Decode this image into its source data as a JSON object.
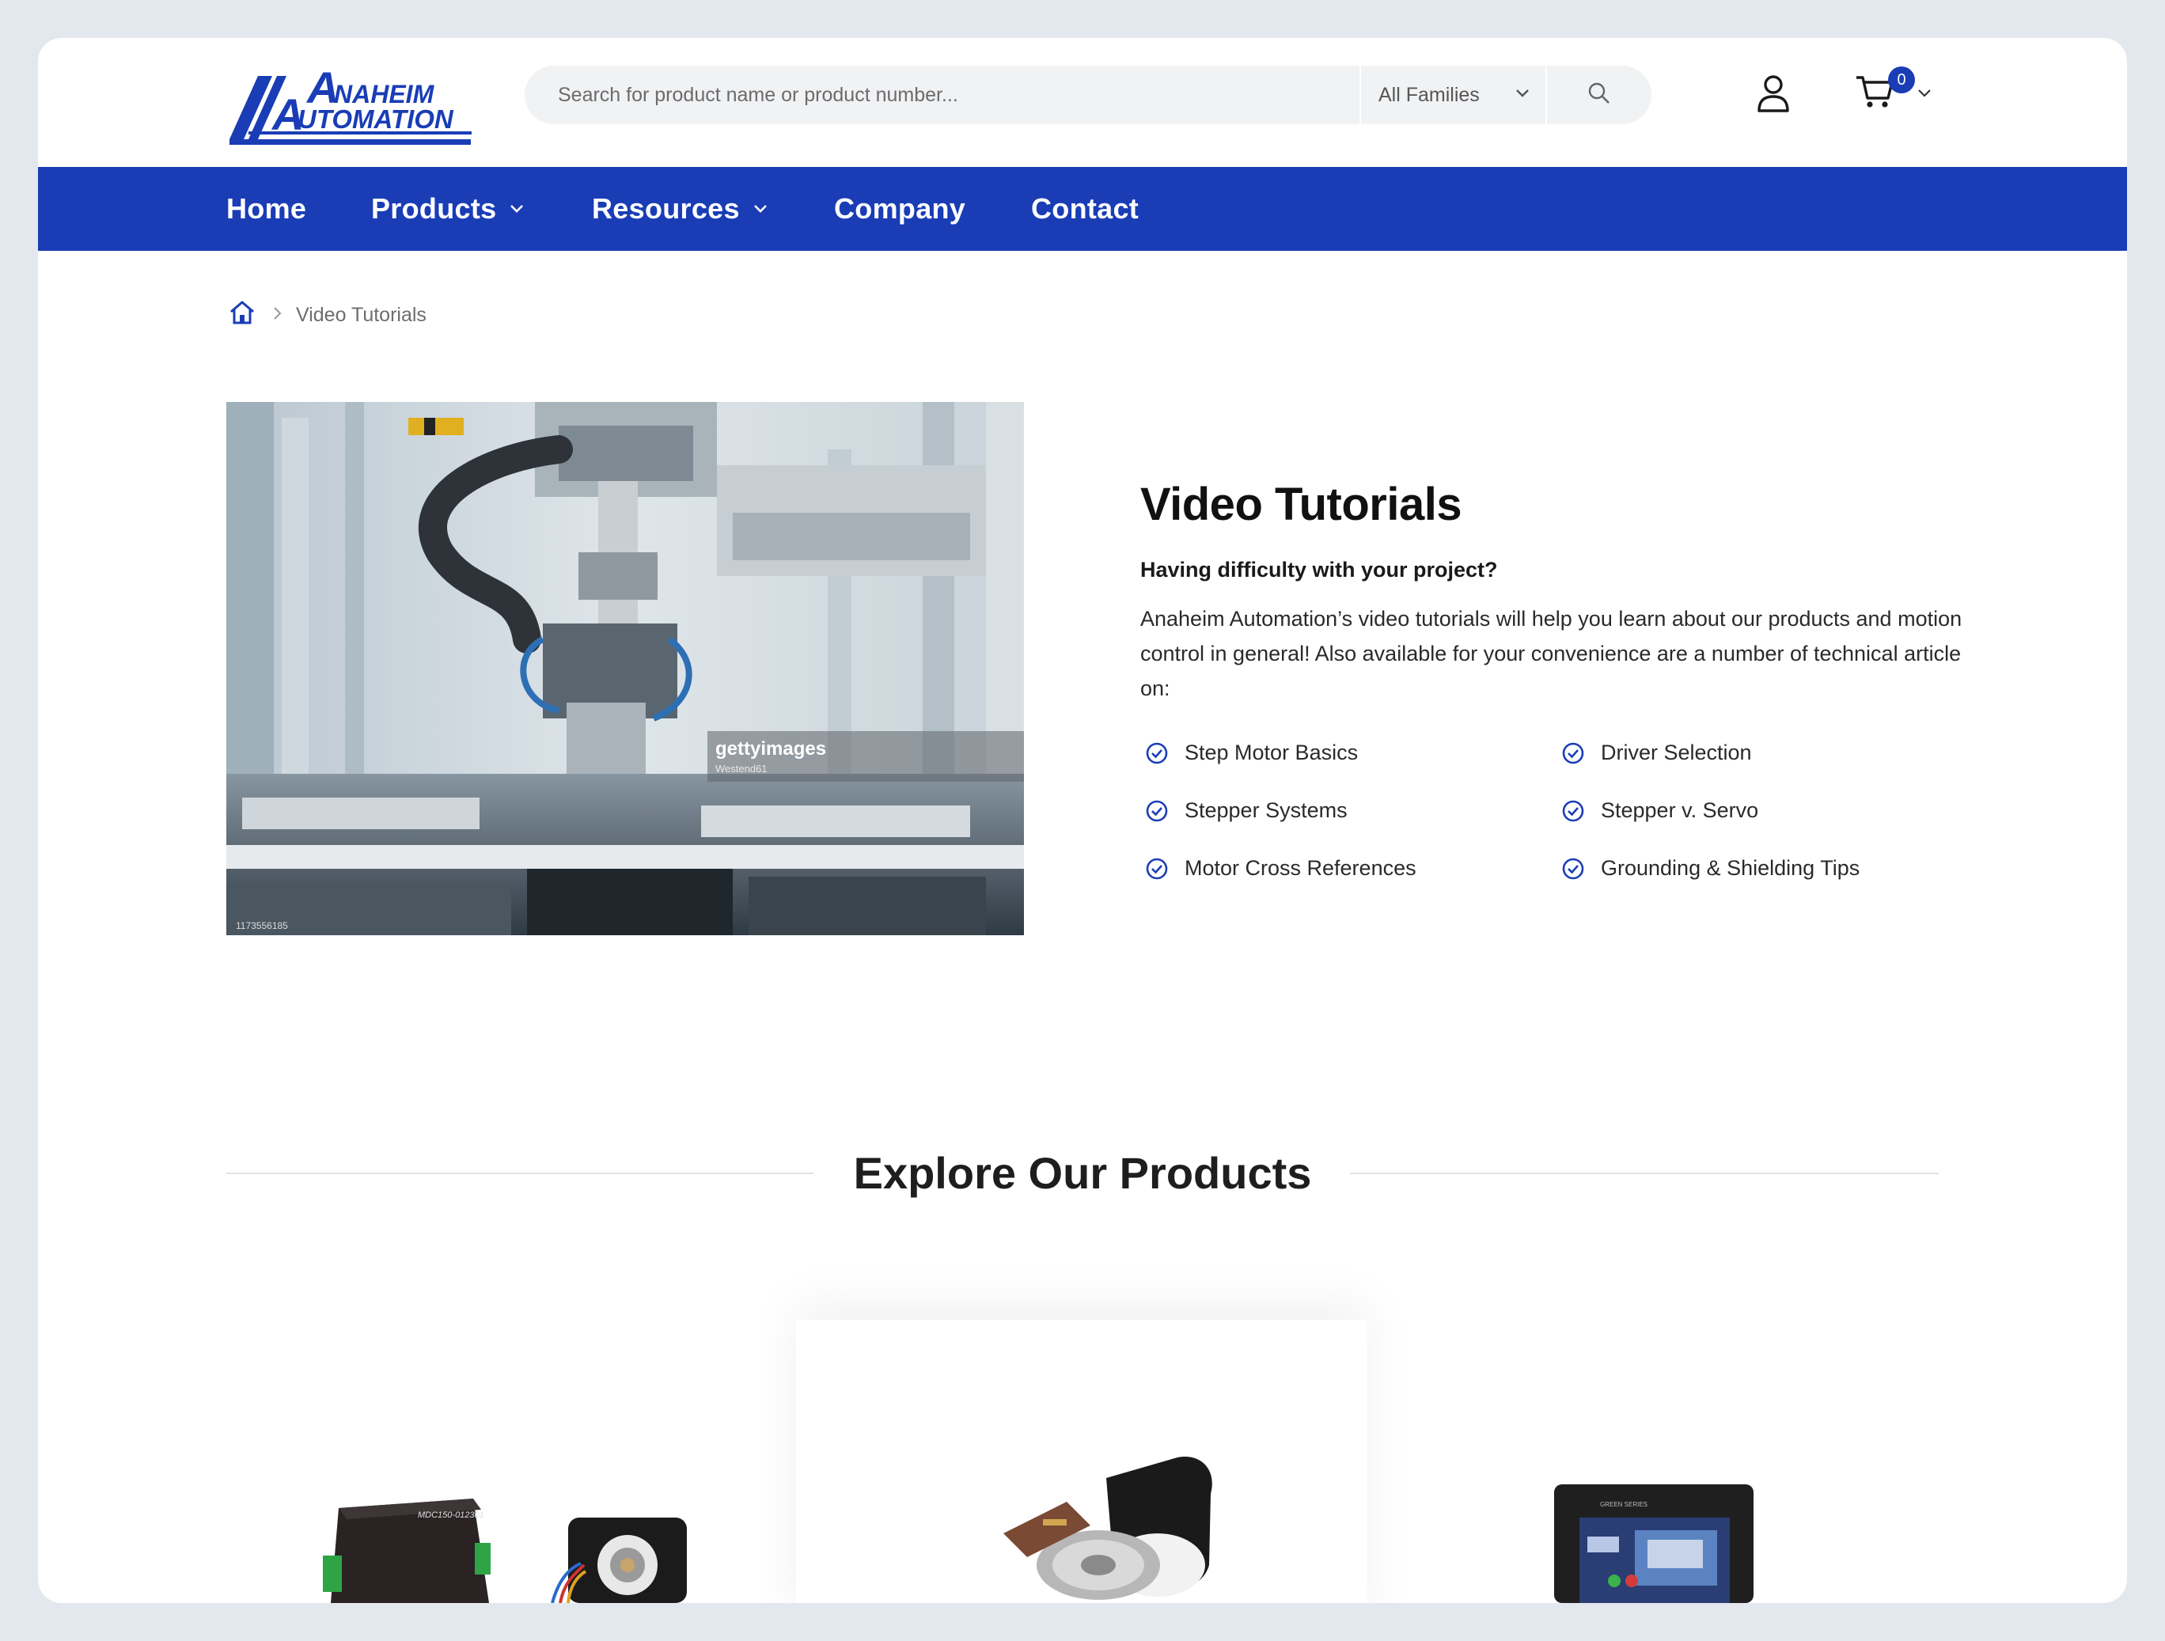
{
  "brand": {
    "logo_line1": "NAHEIM",
    "logo_line2": "UTOMATION",
    "logo_letter1": "A",
    "logo_letter2": "A",
    "color": "#1a3db6"
  },
  "search": {
    "placeholder": "Search for product name or product number...",
    "family_selected": "All Families"
  },
  "cart": {
    "count": "0"
  },
  "nav": {
    "items": [
      {
        "label": "Home"
      },
      {
        "label": "Products"
      },
      {
        "label": "Resources"
      },
      {
        "label": "Company"
      },
      {
        "label": "Contact"
      }
    ]
  },
  "breadcrumb": {
    "current": "Video Tutorials"
  },
  "hero": {
    "watermark": "gettyimages",
    "watermark_sub": "Westend61",
    "image_id": "1173556185"
  },
  "content": {
    "title": "Video Tutorials",
    "subtitle": "Having difficulty with your project?",
    "description": "Anaheim Automation’s video tutorials will help you learn about our products and motion control in general! Also available for your convenience are a number of technical article on:",
    "topics": [
      "Step Motor Basics",
      "Stepper Systems",
      "Motor Cross References",
      "Driver Selection",
      "Stepper v. Servo",
      "Grounding & Shielding Tips"
    ]
  },
  "explore": {
    "title": "Explore Our Products",
    "products": [
      {
        "label_a": "MDC150-012301"
      },
      {
        "label_b": "GREEN SERIES"
      }
    ]
  }
}
